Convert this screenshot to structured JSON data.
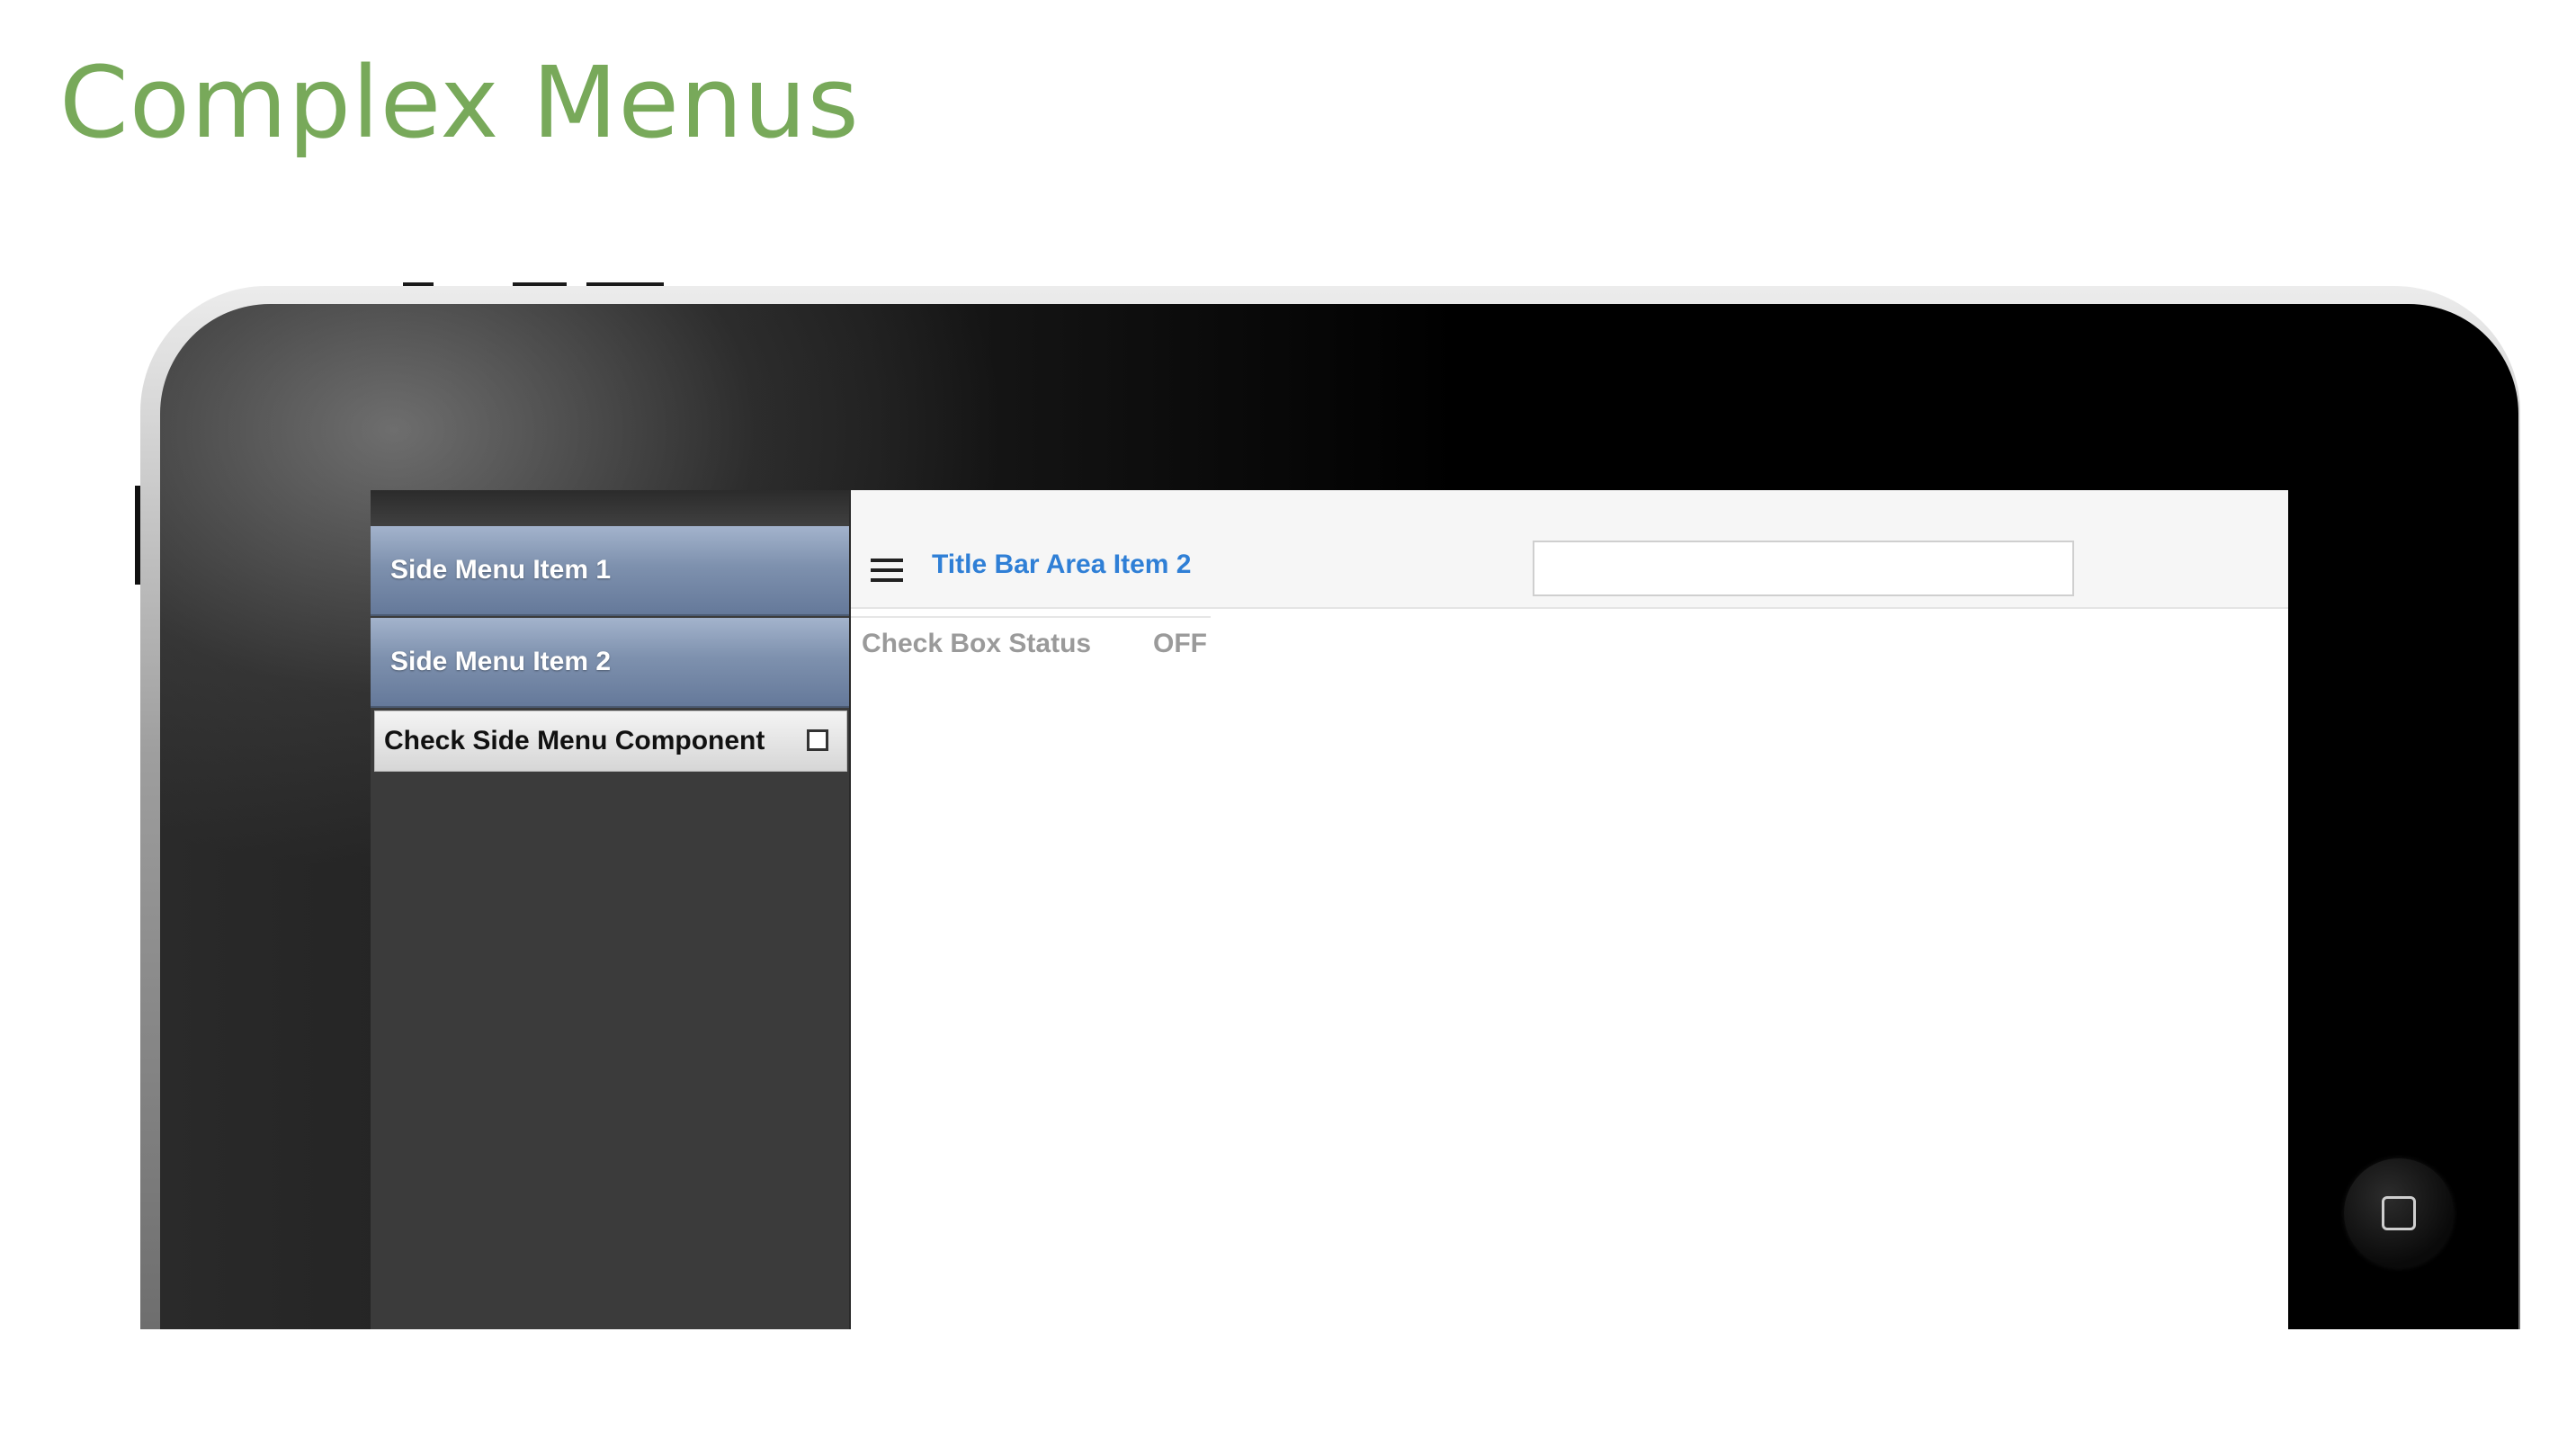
{
  "slide": {
    "title": "Complex Menus"
  },
  "side_menu": {
    "items": [
      {
        "label": "Side Menu Item 1"
      },
      {
        "label": "Side Menu Item 2"
      }
    ],
    "check_component": {
      "label": "Check Side Menu Component",
      "checked": false
    }
  },
  "title_bar": {
    "menu_icon": "hamburger-menu-icon",
    "link_label": "Title Bar Area Item 2",
    "input_value": "",
    "input_placeholder": ""
  },
  "content": {
    "status_label": "Check Box Status",
    "status_value": "OFF"
  },
  "device": {
    "home_icon": "home-button-icon"
  },
  "colors": {
    "title_green": "#78a95a",
    "link_blue": "#2f7fd6",
    "menu_item_blue": "#7e91ae",
    "side_menu_bg": "#3b3b3b"
  }
}
